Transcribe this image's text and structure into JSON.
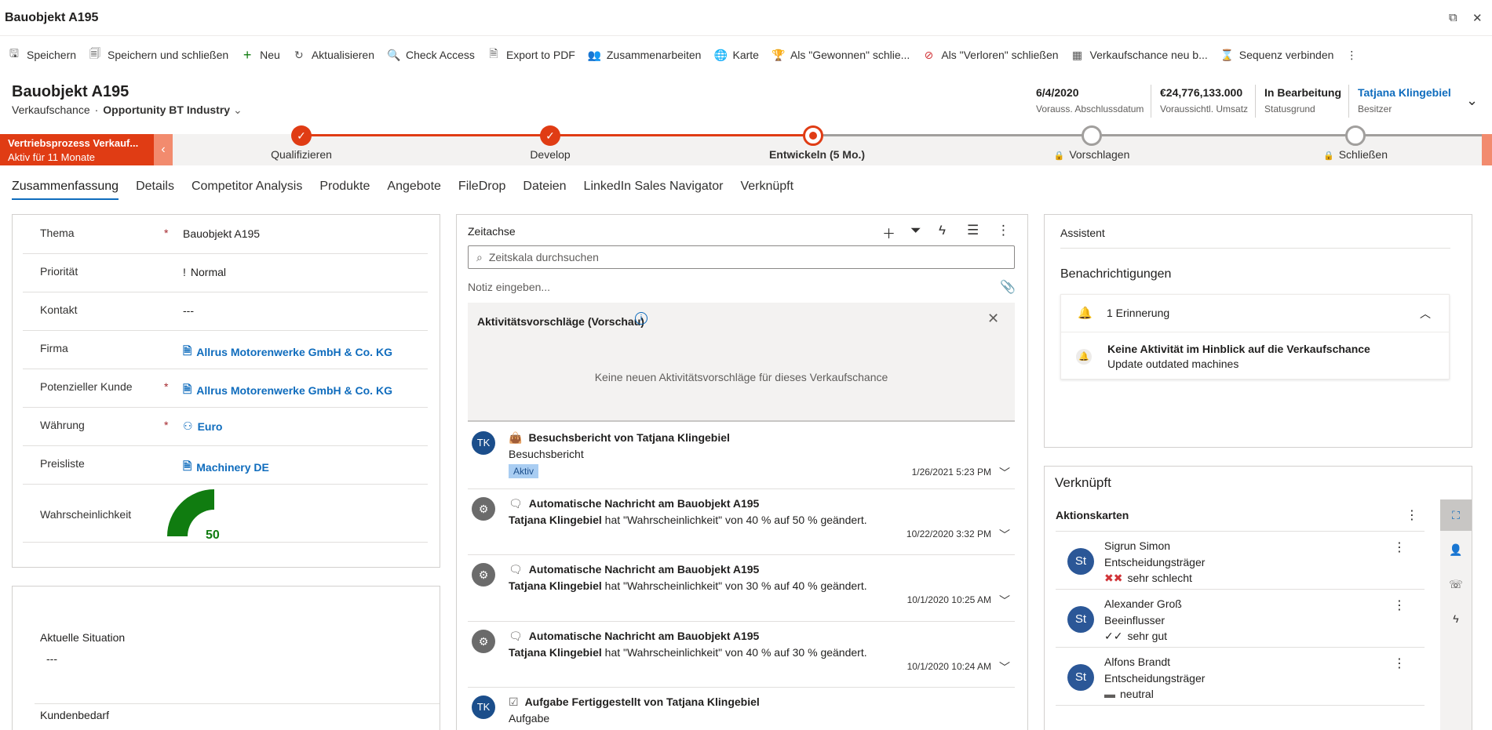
{
  "window": {
    "title": "Bauobjekt A195",
    "restore_icon": "restore-icon",
    "close_icon": "close-icon",
    "close_glyph": "✕",
    "restore_glyph": "⧉"
  },
  "toolbar": {
    "items": [
      {
        "label": "Speichern",
        "icon": "save-icon",
        "glyph": "🖫"
      },
      {
        "label": "Speichern und schließen",
        "icon": "save-close-icon",
        "glyph": "🗐"
      },
      {
        "label": "Neu",
        "icon": "plus-icon",
        "glyph": "+"
      },
      {
        "label": "Aktualisieren",
        "icon": "refresh-icon",
        "glyph": "↻"
      },
      {
        "label": "Check Access",
        "icon": "key-icon",
        "glyph": "🔍"
      },
      {
        "label": "Export to PDF",
        "icon": "pdf-icon",
        "glyph": "🗎"
      },
      {
        "label": "Zusammenarbeiten",
        "icon": "teams-icon",
        "glyph": "👥"
      },
      {
        "label": "Karte",
        "icon": "globe-icon",
        "glyph": "🌐"
      },
      {
        "label": "Als \"Gewonnen\" schlie...",
        "icon": "trophy-icon",
        "glyph": "🏆"
      },
      {
        "label": "Als \"Verloren\" schließen",
        "icon": "block-icon",
        "glyph": "⊘"
      },
      {
        "label": "Verkaufschance neu b...",
        "icon": "calculator-icon",
        "glyph": "▦"
      },
      {
        "label": "Sequenz verbinden",
        "icon": "sequence-icon",
        "glyph": "⌛"
      }
    ],
    "more_glyph": "⋮"
  },
  "header": {
    "title": "Bauobjekt A195",
    "entity": "Verkaufschance",
    "separator": "·",
    "form": "Opportunity BT Industry",
    "fields": [
      {
        "value": "6/4/2020",
        "label": "Vorauss. Abschlussdatum"
      },
      {
        "value": "€24,776,133.000",
        "label": "Voraussichtl. Umsatz"
      },
      {
        "value": "In Bearbeitung",
        "label": "Statusgrund"
      },
      {
        "value": "Tatjana Klingebiel",
        "label": "Besitzer"
      }
    ],
    "chevron": "⌄"
  },
  "bpf": {
    "process": "Vertriebsprozess Verkauf...",
    "duration": "Aktiv für 11 Monate",
    "stages": [
      {
        "label": "Qualifizieren",
        "state": "done"
      },
      {
        "label": "Develop",
        "state": "done"
      },
      {
        "label": "Entwickeln  (5 Mo.)",
        "state": "active"
      },
      {
        "label": "Vorschlagen",
        "state": "locked"
      },
      {
        "label": "Schließen",
        "state": "locked"
      }
    ],
    "check": "✓",
    "lock": "🔒",
    "prev": "‹"
  },
  "tabs": [
    "Zusammenfassung",
    "Details",
    "Competitor Analysis",
    "Produkte",
    "Angebote",
    "FileDrop",
    "Dateien",
    "LinkedIn Sales Navigator",
    "Verknüpft"
  ],
  "summary": {
    "fields": [
      {
        "label": "Thema",
        "required": true,
        "value": "Bauobjekt A195",
        "link": false,
        "icon": ""
      },
      {
        "label": "Priorität",
        "required": false,
        "value": "Normal",
        "link": false,
        "icon": "!"
      },
      {
        "label": "Kontakt",
        "required": false,
        "value": "---",
        "link": false,
        "icon": ""
      },
      {
        "label": "Firma",
        "required": false,
        "value": "Allrus Motorenwerke GmbH & Co. KG",
        "link": true,
        "icon": "🗎"
      },
      {
        "label": "Potenzieller Kunde",
        "required": true,
        "value": "Allrus Motorenwerke GmbH & Co. KG",
        "link": true,
        "icon": "🗎"
      },
      {
        "label": "Währung",
        "required": true,
        "value": "Euro",
        "link": true,
        "icon": "⚇"
      },
      {
        "label": "Preisliste",
        "required": false,
        "value": "Machinery DE",
        "link": true,
        "icon": "🗎"
      }
    ],
    "required_mark": "*",
    "probability_label": "Wahrscheinlichkeit",
    "probability": 50,
    "probability_text": "50",
    "gauge_color": "#107c10"
  },
  "section2": {
    "situation_label": "Aktuelle Situation",
    "situation_value": "---",
    "need_label": "Kundenbedarf"
  },
  "timeline": {
    "title": "Zeitachse",
    "search_placeholder": "Zeitskala durchsuchen",
    "note_placeholder": "Notiz eingeben...",
    "suggestions_title": "Aktivitätsvorschläge (Vorschau)",
    "suggestions_empty": "Keine neuen Aktivitätsvorschläge für dieses Verkaufschance",
    "items": [
      {
        "avatar": "TK",
        "kind": "tk",
        "title": "Besuchsbericht von Tatjana Klingebiel",
        "type_glyph": "👜",
        "line2_strong": "",
        "line2": "Besuchsbericht",
        "badge": "Aktiv",
        "date": "1/26/2021 5:23 PM"
      },
      {
        "avatar": "⚙",
        "kind": "bot",
        "title": "Automatische Nachricht am Bauobjekt A195",
        "type_glyph": "🗨",
        "line2_strong": "Tatjana Klingebiel",
        "line2": " hat \"Wahrscheinlichkeit\" von 40 % auf 50 % geändert.",
        "badge": "",
        "date": "10/22/2020 3:32 PM"
      },
      {
        "avatar": "⚙",
        "kind": "bot",
        "title": "Automatische Nachricht am Bauobjekt A195",
        "type_glyph": "🗨",
        "line2_strong": "Tatjana Klingebiel",
        "line2": " hat \"Wahrscheinlichkeit\" von 30 % auf 40 % geändert.",
        "badge": "",
        "date": "10/1/2020 10:25 AM"
      },
      {
        "avatar": "⚙",
        "kind": "bot",
        "title": "Automatische Nachricht am Bauobjekt A195",
        "type_glyph": "🗨",
        "line2_strong": "Tatjana Klingebiel",
        "line2": " hat \"Wahrscheinlichkeit\" von 40 % auf 30 % geändert.",
        "badge": "",
        "date": "10/1/2020 10:24 AM"
      },
      {
        "avatar": "TK",
        "kind": "tk",
        "title": "Aufgabe Fertiggestellt von Tatjana Klingebiel",
        "type_glyph": "☑",
        "line2_strong": "",
        "line2": "Aufgabe",
        "badge": "",
        "date": ""
      }
    ]
  },
  "assistant": {
    "title": "Assistent",
    "notifications_title": "Benachrichtigungen",
    "reminder_count": "1 Erinnerung",
    "notice_title": "Keine Aktivität im Hinblick auf die Verkaufschance",
    "notice_sub": "Update outdated machines"
  },
  "related": {
    "title": "Verknüpft",
    "cards_title": "Aktionskarten",
    "contacts": [
      {
        "initials": "St",
        "name": "Sigrun Simon",
        "role": "Entscheidungsträger",
        "sentiment_glyph": "✖✖",
        "sentiment": "sehr schlecht",
        "tone": "bad"
      },
      {
        "initials": "St",
        "name": "Alexander Groß",
        "role": "Beeinflusser",
        "sentiment_glyph": "✓✓",
        "sentiment": "sehr gut",
        "tone": "good"
      },
      {
        "initials": "St",
        "name": "Alfons Brandt",
        "role": "Entscheidungsträger",
        "sentiment_glyph": "▬",
        "sentiment": "neutral",
        "tone": "neutral"
      }
    ]
  }
}
